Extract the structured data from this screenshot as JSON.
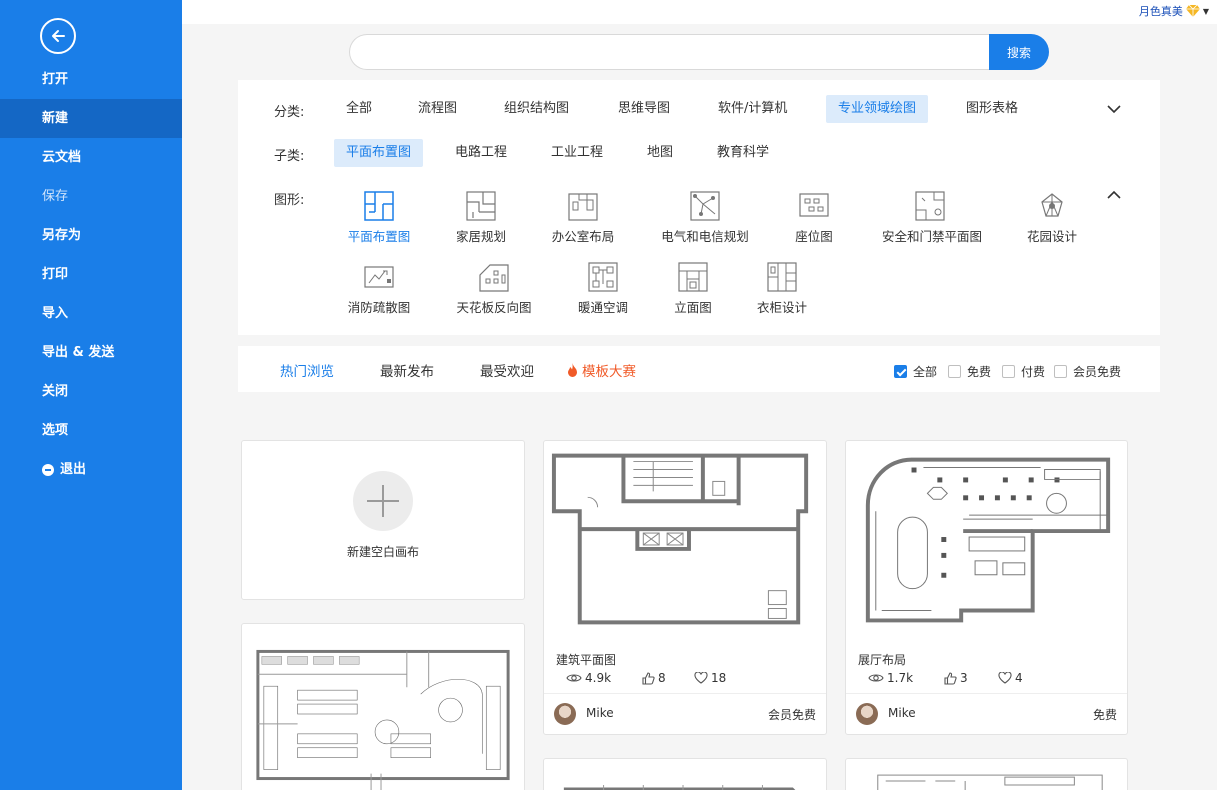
{
  "sidebar": {
    "items": [
      {
        "label": "打开",
        "state": "normal"
      },
      {
        "label": "新建",
        "state": "active"
      },
      {
        "label": "云文档",
        "state": "normal"
      },
      {
        "label": "保存",
        "state": "muted"
      },
      {
        "label": "另存为",
        "state": "normal"
      },
      {
        "label": "打印",
        "state": "normal"
      },
      {
        "label": "导入",
        "state": "normal"
      },
      {
        "label": "导出 & 发送",
        "state": "normal"
      },
      {
        "label": "关闭",
        "state": "normal"
      },
      {
        "label": "选项",
        "state": "normal"
      },
      {
        "label": "退出",
        "state": "normal"
      }
    ]
  },
  "user": {
    "name": "月色真美"
  },
  "search": {
    "placeholder": "",
    "button": "搜索"
  },
  "filters": {
    "category_label": "分类:",
    "categories": [
      "全部",
      "流程图",
      "组织结构图",
      "思维导图",
      "软件/计算机",
      "专业领域绘图",
      "图形表格"
    ],
    "category_selected": "专业领域绘图",
    "sub_label": "子类:",
    "subcategories": [
      "平面布置图",
      "电路工程",
      "工业工程",
      "地图",
      "教育科学"
    ],
    "sub_selected": "平面布置图",
    "shape_label": "图形:",
    "shapes": [
      "平面布置图",
      "家居规划",
      "办公室布局",
      "电气和电信规划",
      "座位图",
      "安全和门禁平面图",
      "花园设计",
      "消防疏散图",
      "天花板反向图",
      "暖通空调",
      "立面图",
      "衣柜设计"
    ],
    "shape_selected": "平面布置图"
  },
  "tabs": {
    "items": [
      "热门浏览",
      "最新发布",
      "最受欢迎",
      "模板大赛"
    ],
    "selected": "热门浏览",
    "checks": [
      {
        "label": "全部",
        "checked": true
      },
      {
        "label": "免费",
        "checked": false
      },
      {
        "label": "付费",
        "checked": false
      },
      {
        "label": "会员免费",
        "checked": false
      }
    ]
  },
  "blank_card": {
    "label": "新建空白画布"
  },
  "cards": [
    {
      "title": "建筑平面图",
      "views": "4.9k",
      "likes": "8",
      "favorites": "18",
      "author": "Mike",
      "price": "会员免费"
    },
    {
      "title": "展厅布局",
      "views": "1.7k",
      "likes": "3",
      "favorites": "4",
      "author": "Mike",
      "price": "免费"
    }
  ],
  "colors": {
    "accent": "#1a7ee8",
    "sidebar": "#1a7ee8",
    "sidebar_active": "#1467c5",
    "contest": "#f05a28"
  }
}
